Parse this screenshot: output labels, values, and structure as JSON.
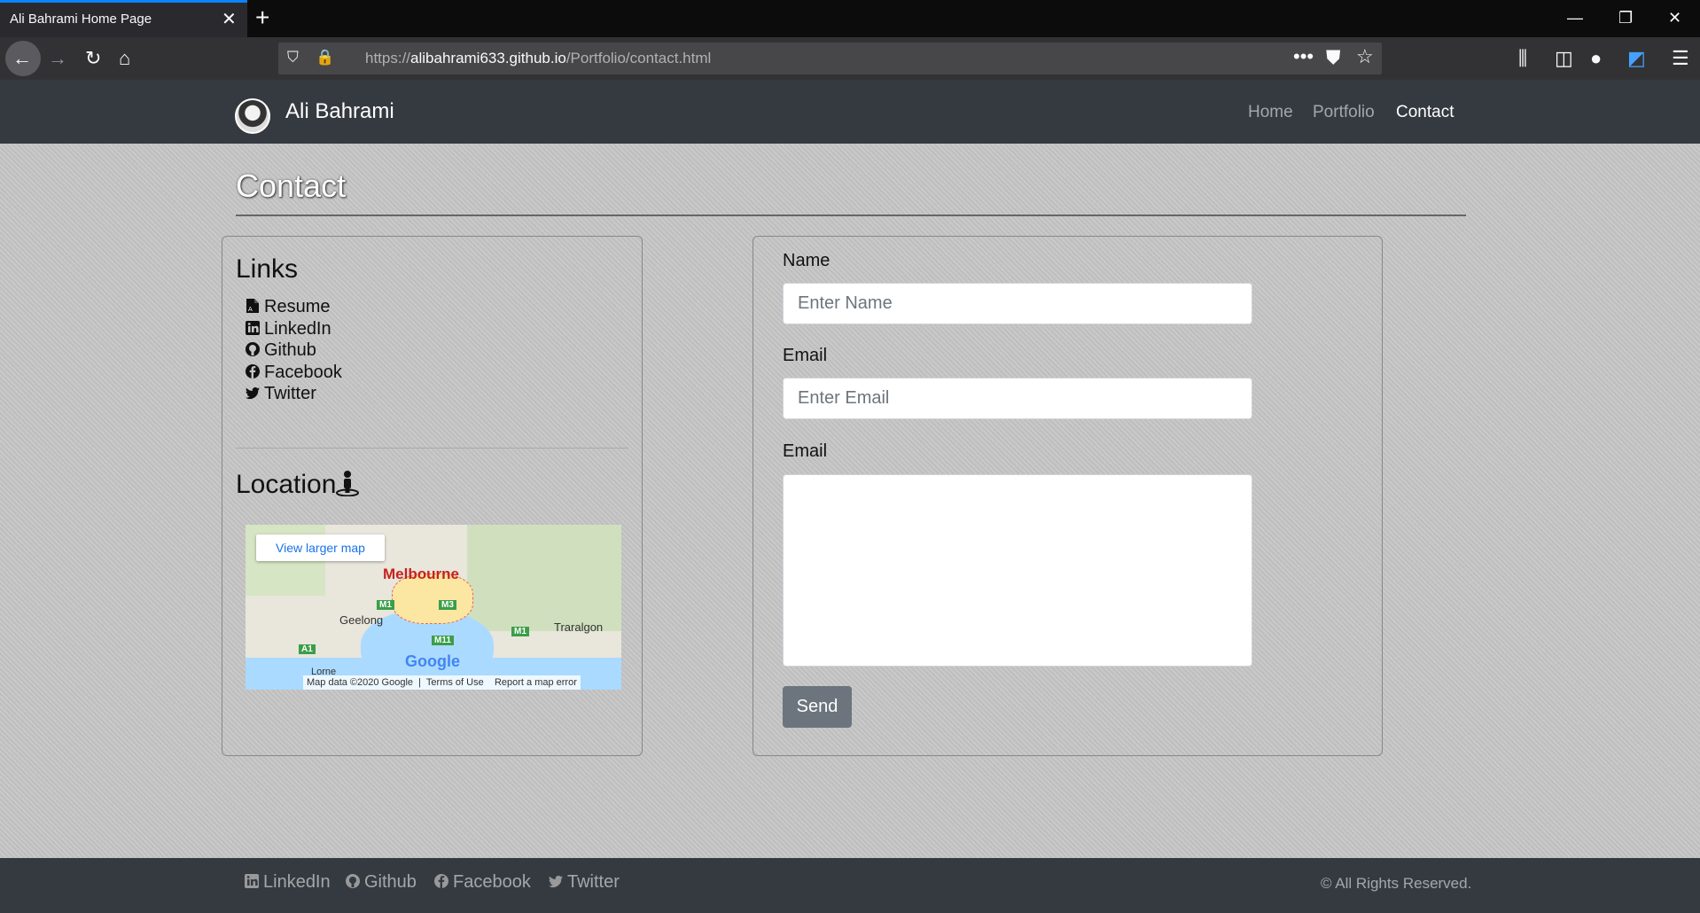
{
  "browser": {
    "tab_title": "Ali Bahrami Home Page",
    "url_scheme": "https://",
    "url_host": "alibahrami633.github.io",
    "url_path": "/Portfolio/contact.html"
  },
  "site": {
    "brand": "Ali Bahrami",
    "nav": [
      "Home",
      "Portfolio",
      "Contact"
    ],
    "active_nav": "Contact"
  },
  "page": {
    "title": "Contact"
  },
  "links": {
    "heading": "Links",
    "items": [
      "Resume",
      "LinkedIn",
      "Github",
      "Facebook",
      "Twitter"
    ]
  },
  "location": {
    "heading": "Location",
    "map": {
      "view_larger": "View larger map",
      "city": "Melbourne",
      "labels": [
        "Geelong",
        "Traralgon",
        "Lorne"
      ],
      "roads": [
        "M1",
        "M3",
        "M11",
        "A1",
        "M1"
      ],
      "logo": "Google",
      "footer": [
        "Map data ©2020 Google",
        "Terms of Use",
        "Report a map error"
      ]
    }
  },
  "form": {
    "name_label": "Name",
    "name_placeholder": "Enter Name",
    "email_label": "Email",
    "email_placeholder": "Enter Email",
    "message_label": "Email",
    "send": "Send"
  },
  "footer": {
    "links": [
      "LinkedIn",
      "Github",
      "Facebook",
      "Twitter"
    ],
    "copyright": "© All Rights Reserved."
  },
  "colors": {
    "navbar": "#343a40",
    "accent_tab": "#0a84ff",
    "button": "#6c757d"
  }
}
